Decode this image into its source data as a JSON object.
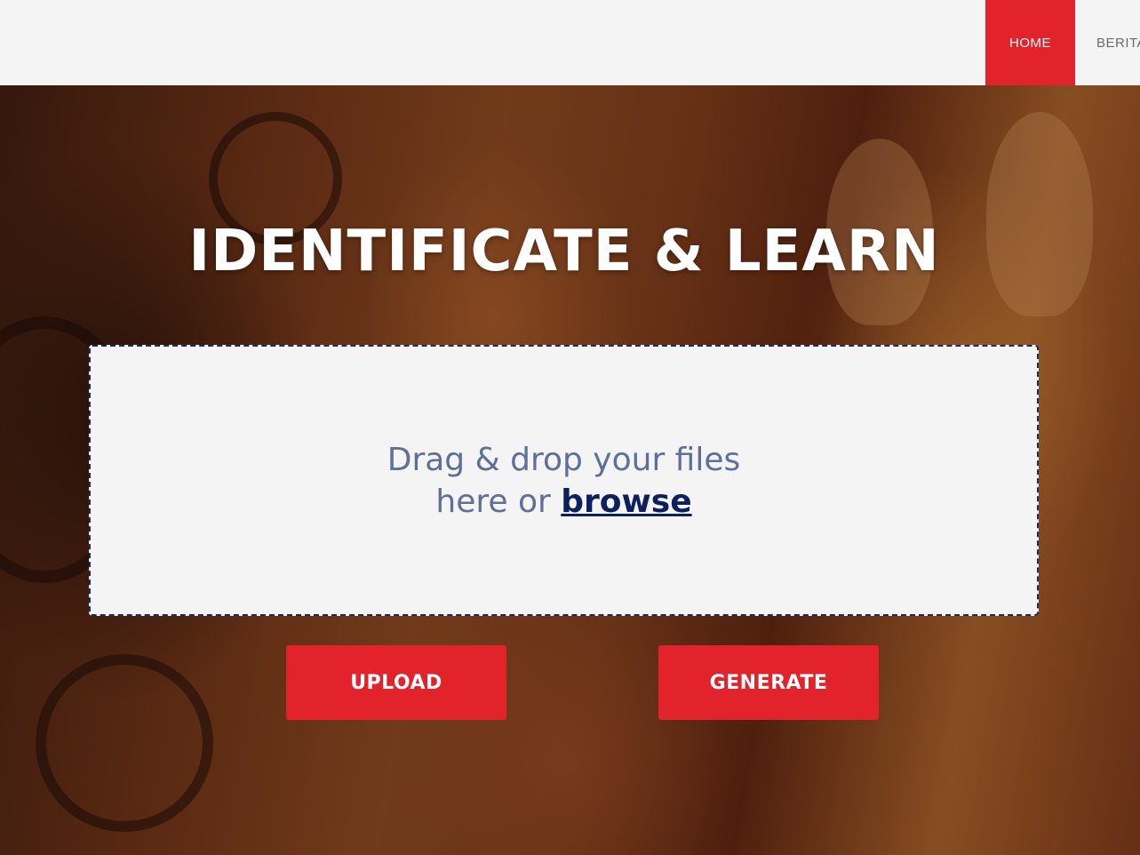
{
  "nav": {
    "items": [
      {
        "label": "HOME",
        "active": true
      },
      {
        "label": "BERITA",
        "active": false
      }
    ],
    "active_color": "#e3232c"
  },
  "hero": {
    "title": "IDENTIFICATE & LEARN",
    "dropzone": {
      "line1": "Drag & drop your files",
      "line2_prefix": "here or",
      "browse_label": "browse"
    },
    "buttons": {
      "upload_label": "UPLOAD",
      "generate_label": "GENERATE"
    },
    "accent_color": "#e3232c"
  }
}
